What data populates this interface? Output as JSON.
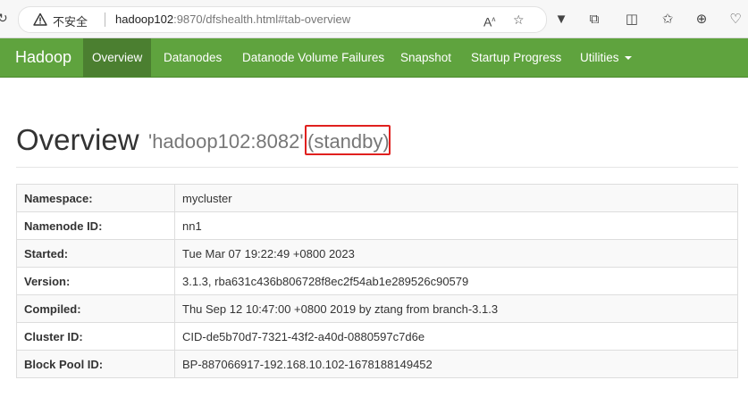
{
  "browser": {
    "insecure_label": "不安全",
    "url_host": "hadoop102",
    "url_rest": ":9870/dfshealth.html#tab-overview"
  },
  "navbar": {
    "brand": "Hadoop",
    "items": [
      {
        "label": "Overview",
        "active": true
      },
      {
        "label": "Datanodes"
      },
      {
        "label": "Datanode Volume Failures"
      },
      {
        "label": "Snapshot"
      },
      {
        "label": "Startup Progress"
      },
      {
        "label": "Utilities"
      }
    ]
  },
  "header": {
    "title": "Overview",
    "host": "'hadoop102:8082'",
    "state": "(standby)"
  },
  "table": [
    {
      "key": "Namespace:",
      "value": "mycluster"
    },
    {
      "key": "Namenode ID:",
      "value": "nn1"
    },
    {
      "key": "Started:",
      "value": "Tue Mar 07 19:22:49 +0800 2023"
    },
    {
      "key": "Version:",
      "value": "3.1.3, rba631c436b806728f8ec2f54ab1e289526c90579"
    },
    {
      "key": "Compiled:",
      "value": "Thu Sep 12 10:47:00 +0800 2019 by ztang from branch-3.1.3"
    },
    {
      "key": "Cluster ID:",
      "value": "CID-de5b70d7-7321-43f2-a40d-0880597c7d6e"
    },
    {
      "key": "Block Pool ID:",
      "value": "BP-887066917-192.168.10.102-1678188149452"
    }
  ],
  "colors": {
    "navbar": "#5fa33e",
    "navbar_active": "#4b7f30",
    "highlight_box": "#e0201e"
  }
}
